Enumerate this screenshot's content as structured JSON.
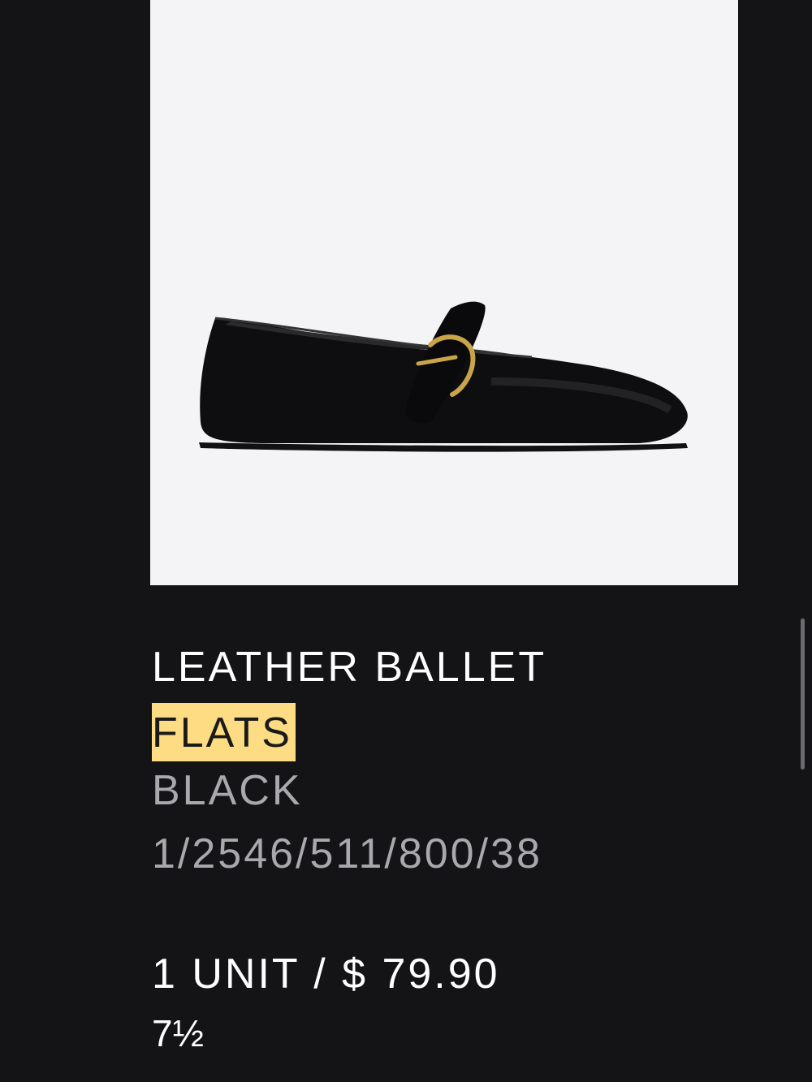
{
  "product": {
    "title_line1": "LEATHER BALLET",
    "title_line2_highlighted": "FLATS",
    "color": "BLACK",
    "reference": "1/2546/511/800/38",
    "quantity_price": "1 UNIT / $ 79.90",
    "size": "7½"
  },
  "colors": {
    "background": "#141416",
    "image_background": "#f4f4f7",
    "highlight": "#fddc83",
    "secondary_text": "#a9a9ad"
  }
}
